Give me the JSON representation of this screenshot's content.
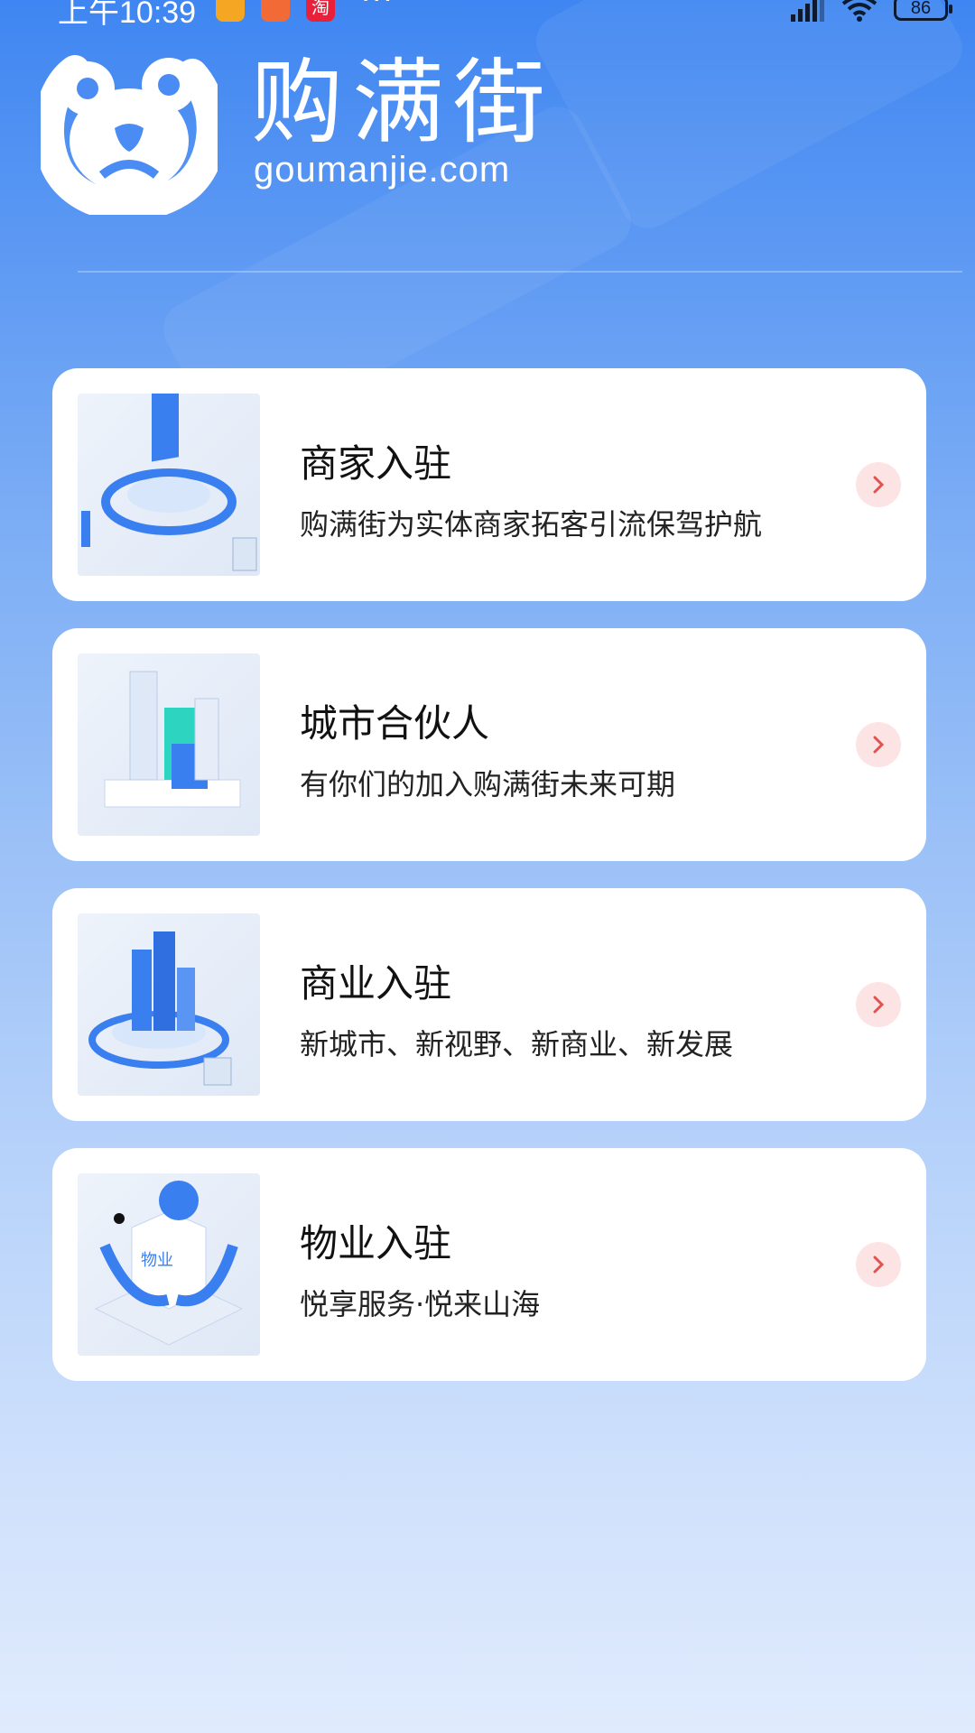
{
  "status_bar": {
    "time": "上午10:39",
    "app_badge_tao": "淘",
    "overflow": "···",
    "battery": "86"
  },
  "brand": {
    "name": "购满街",
    "domain": "goumanjie.com"
  },
  "accent": {
    "arrow_bg": "#fde4e4",
    "arrow_color": "#e0534f",
    "blue": "#3a7ff0"
  },
  "cards": [
    {
      "title": "商家入驻",
      "desc": "购满街为实体商家拓客引流保驾护航",
      "icon": "merchant-platform-illustration"
    },
    {
      "title": "城市合伙人",
      "desc": "有你们的加入购满街未来可期",
      "icon": "city-buildings-illustration"
    },
    {
      "title": "商业入驻",
      "desc": "新城市、新视野、新商业、新发展",
      "icon": "business-tower-illustration"
    },
    {
      "title": "物业入驻",
      "desc": "悦享服务·悦来山海",
      "icon": "property-box-illustration",
      "thumb_label": "物业"
    }
  ]
}
